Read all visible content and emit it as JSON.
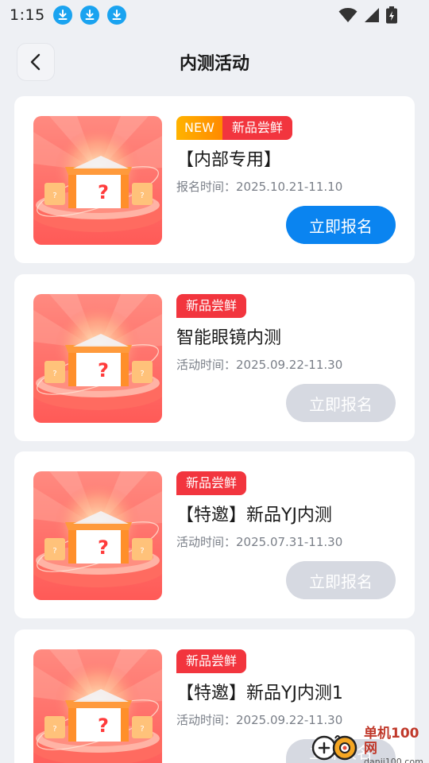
{
  "status_bar": {
    "time": "1:15",
    "icons": [
      "download-icon",
      "download-icon",
      "download-icon",
      "wifi-icon",
      "signal-icon",
      "battery-icon"
    ]
  },
  "header": {
    "title": "内测活动",
    "back_icon": "chevron-left-icon"
  },
  "activities": [
    {
      "new_badge": "NEW",
      "tag": "新品尝鲜",
      "title": "【内部专用】",
      "time": "报名时间：2025.10.21-11.10",
      "button": "立即报名",
      "button_state": "active"
    },
    {
      "tag": "新品尝鲜",
      "title": "智能眼镜内测",
      "time": "活动时间：2025.09.22-11.30",
      "button": "立即报名",
      "button_state": "disabled"
    },
    {
      "tag": "新品尝鲜",
      "title": "【特邀】新品YJ内测",
      "time": "活动时间：2025.07.31-11.30",
      "button": "立即报名",
      "button_state": "disabled"
    },
    {
      "tag": "新品尝鲜",
      "title": "【特邀】新品YJ内测1",
      "time": "活动时间：2025.09.22-11.30",
      "button": "立即报名",
      "button_state": "disabled"
    }
  ],
  "watermark": {
    "name": "单机100网",
    "domain": "danji100.com"
  },
  "colors": {
    "primary_button": "#0a84f0",
    "disabled_button": "#d6d9e1",
    "tag_red": "#f2353e",
    "new_orange": "#ff9d00",
    "background": "#eef0f4"
  }
}
